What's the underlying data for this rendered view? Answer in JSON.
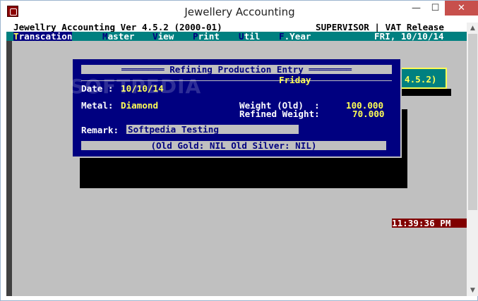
{
  "window": {
    "title": "Jewellery Accounting",
    "minimize_glyph": "—",
    "maximize_glyph": "☐",
    "close_glyph": "✕"
  },
  "header": {
    "left": "Jewellry Accounting Ver 4.5.2 (2000-01)",
    "right": "SUPERVISOR | VAT Release"
  },
  "menu": {
    "items": [
      {
        "hotkey": "T",
        "rest": "ranscation"
      },
      {
        "hotkey": "M",
        "rest": "aster"
      },
      {
        "hotkey": "V",
        "rest": "iew"
      },
      {
        "hotkey": "P",
        "rest": "rint"
      },
      {
        "hotkey": "U",
        "rest": "til"
      },
      {
        "hotkey": "F",
        "rest": ".Year"
      }
    ],
    "date": "FRI, 10/10/14"
  },
  "background_box": {
    "text": "4.5.2)"
  },
  "dialog": {
    "title": "════════ Refining Production Entry ════════",
    "day": "Friday",
    "date_label": "Date :",
    "date_value": "10/10/14",
    "metal_label": "Metal:",
    "metal_value": "Diamond",
    "weight_old_label": "Weight (Old)  :",
    "weight_old_value": "100.000",
    "refined_weight_label": "Refined Weight:",
    "refined_weight_value": "70.000",
    "remark_label": "Remark:",
    "remark_value": "Softpedia Testing",
    "status": "(Old Gold: NIL Old Silver: NIL)"
  },
  "clock": "11:39:36 PM",
  "watermark": "SOFTPEDIA",
  "colors": {
    "console_bg": "#c0c0c0",
    "menu_bg": "#008080",
    "dialog_bg": "#000080",
    "highlight": "#ffff55",
    "clock_bg": "#800000"
  }
}
